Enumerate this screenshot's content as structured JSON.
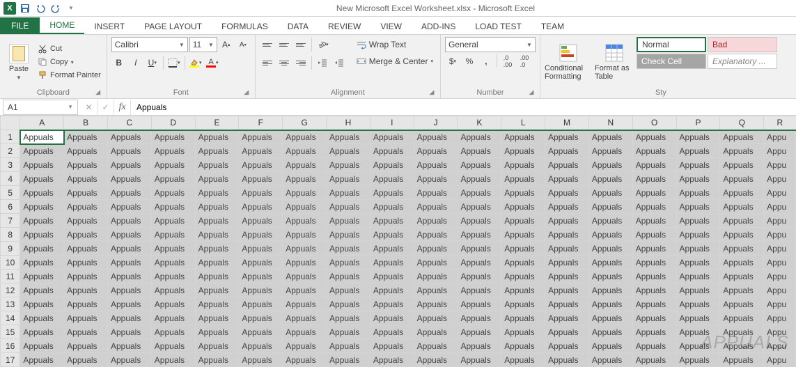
{
  "title": "New Microsoft Excel Worksheet.xlsx - Microsoft Excel",
  "tabs": {
    "file": "FILE",
    "home": "HOME",
    "insert": "INSERT",
    "page_layout": "PAGE LAYOUT",
    "formulas": "FORMULAS",
    "data": "DATA",
    "review": "REVIEW",
    "view": "VIEW",
    "addins": "ADD-INS",
    "load_test": "LOAD TEST",
    "team": "TEAM"
  },
  "clipboard": {
    "paste": "Paste",
    "cut": "Cut",
    "copy": "Copy",
    "format_painter": "Format Painter",
    "group_label": "Clipboard"
  },
  "font": {
    "name": "Calibri",
    "size": "11",
    "group_label": "Font"
  },
  "alignment": {
    "wrap": "Wrap Text",
    "merge": "Merge & Center",
    "group_label": "Alignment"
  },
  "number": {
    "format": "General",
    "group_label": "Number"
  },
  "styles": {
    "conditional": "Conditional Formatting",
    "table": "Format as Table",
    "normal": "Normal",
    "bad": "Bad",
    "check_cell": "Check Cell",
    "explanatory": "Explanatory ...",
    "group_label": "Sty"
  },
  "namebox": "A1",
  "formula": "Appuals",
  "columns": [
    "A",
    "B",
    "C",
    "D",
    "E",
    "F",
    "G",
    "H",
    "I",
    "J",
    "K",
    "L",
    "M",
    "N",
    "O",
    "P",
    "Q",
    "R"
  ],
  "rows": [
    1,
    2,
    3,
    4,
    5,
    6,
    7,
    8,
    9,
    10,
    11,
    12,
    13,
    14,
    15,
    16,
    17
  ],
  "cell_value": "Appuals",
  "last_col_value": "Appu",
  "watermark": "APPUALS"
}
